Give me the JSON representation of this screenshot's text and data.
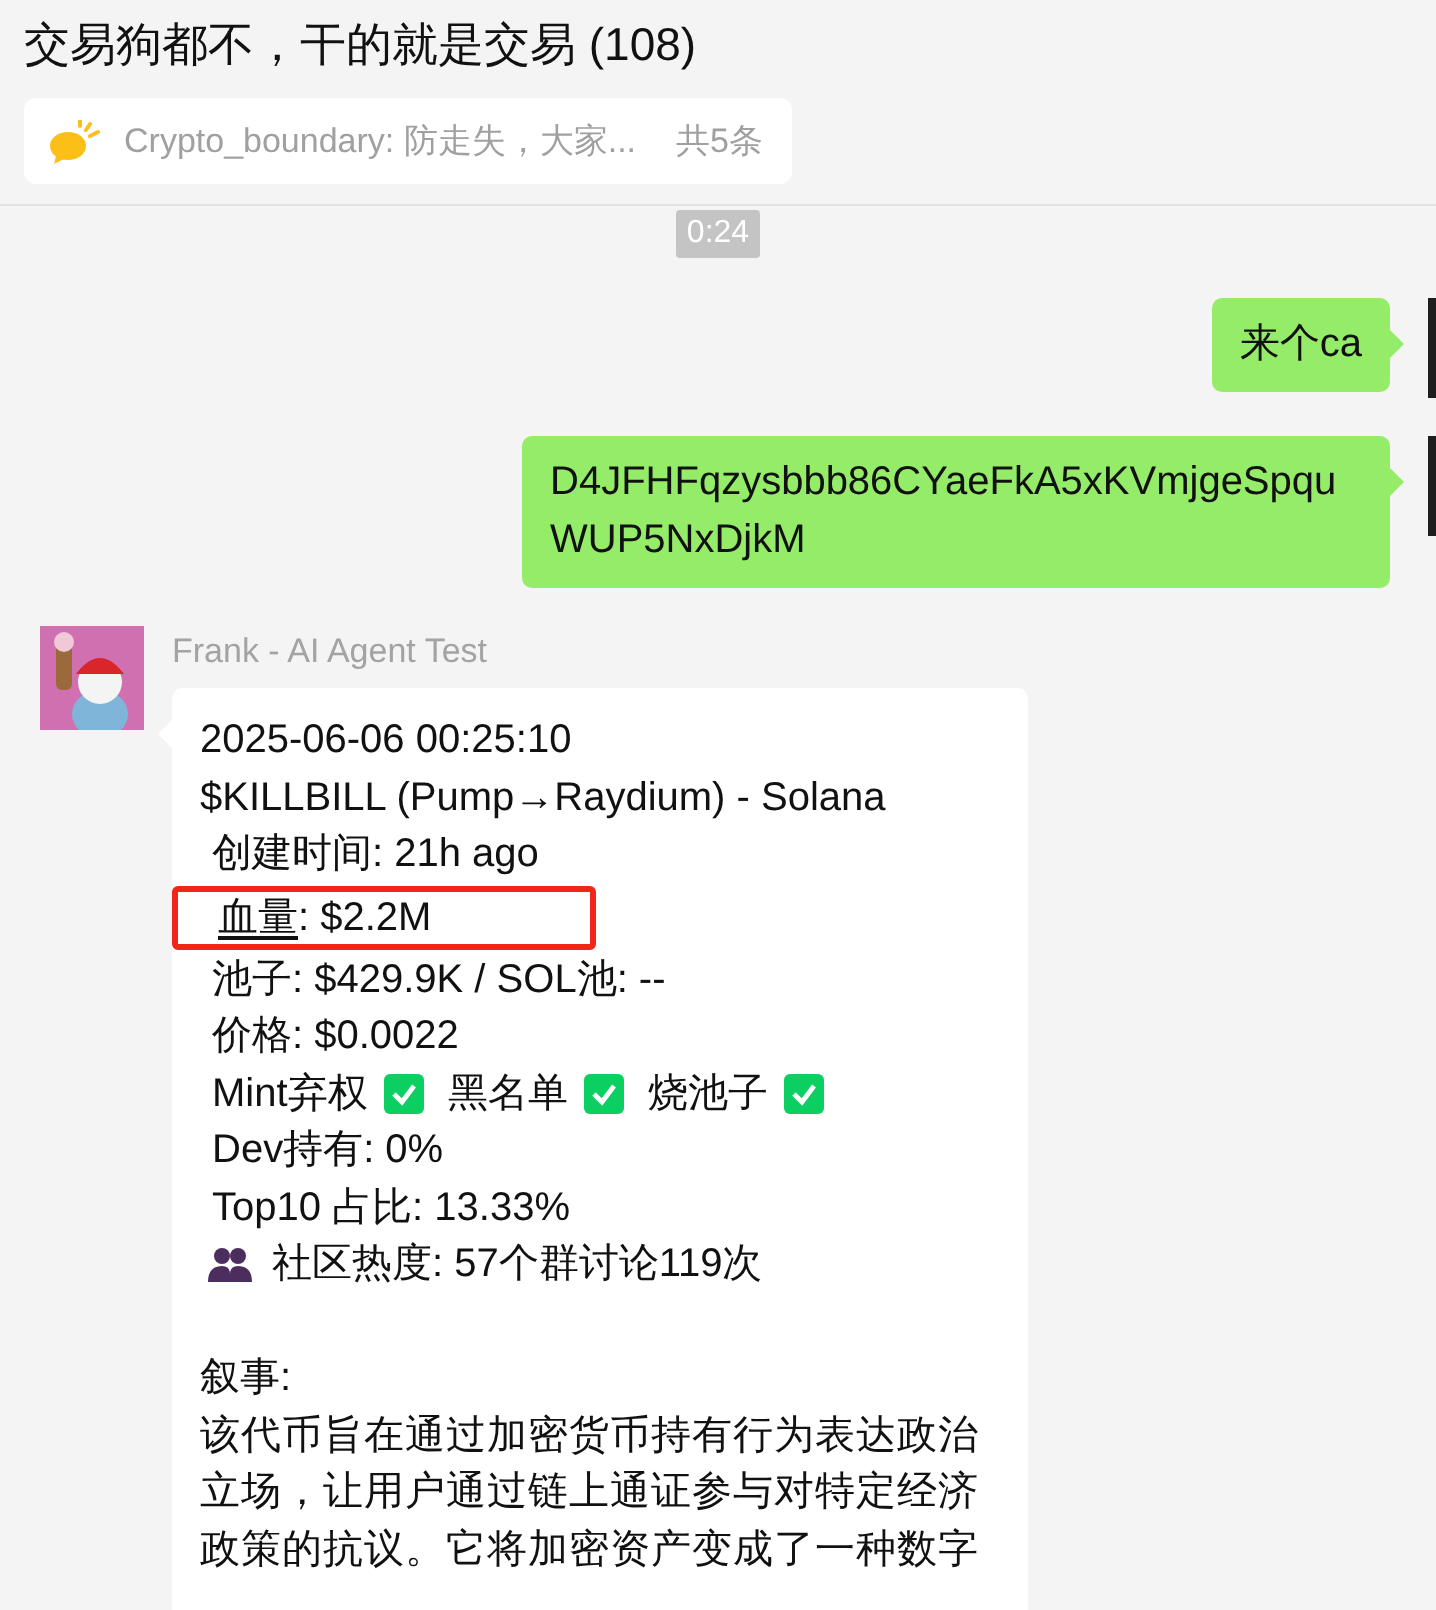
{
  "title": "交易狗都不，干的就是交易 (108)",
  "pinned": {
    "text": "Crypto_boundary: 防走失，大家...",
    "count": "共5条"
  },
  "time": "0:24",
  "messages": [
    {
      "kind": "outgoing",
      "text": "来个ca"
    },
    {
      "kind": "outgoing",
      "text": "D4JFHFqzysbbb86CYaeFkA5xKVmjgeSpquWUP5NxDjkM"
    },
    {
      "kind": "incoming",
      "sender": "Frank - AI Agent Test",
      "lines": [
        {
          "kind": "header",
          "text": "2025-06-06 00:25:10"
        },
        {
          "kind": "header",
          "text": "$KILLBILL (Pump→Raydium) - Solana"
        },
        {
          "kind": "field",
          "text": "创建时间: 21h ago"
        },
        {
          "kind": "highlight",
          "parts": [
            {
              "text": "血量",
              "underline": true
            },
            {
              "text": ": $2.2M",
              "underline": false
            }
          ]
        },
        {
          "kind": "field",
          "text": "池子: $429.9K / SOL池: --"
        },
        {
          "kind": "field",
          "text": "价格: $0.0022"
        },
        {
          "kind": "checks",
          "items": [
            {
              "label": "Mint弃权",
              "checked": true
            },
            {
              "label": "黑名单",
              "checked": true
            },
            {
              "label": "烧池子",
              "checked": true
            }
          ]
        },
        {
          "kind": "field",
          "text": "Dev持有: 0%"
        },
        {
          "kind": "field",
          "text": "Top10 占比: 13.33%"
        },
        {
          "kind": "people",
          "text": "社区热度: 57个群讨论119次"
        },
        {
          "kind": "heading",
          "text": "叙事:"
        },
        {
          "kind": "paragraph",
          "text": "该代币旨在通过加密货币持有行为表达政治立场，让用户通过链上通证参与对特定经济政策的抗议。它将加密资产变成了一种数字"
        }
      ]
    }
  ]
}
